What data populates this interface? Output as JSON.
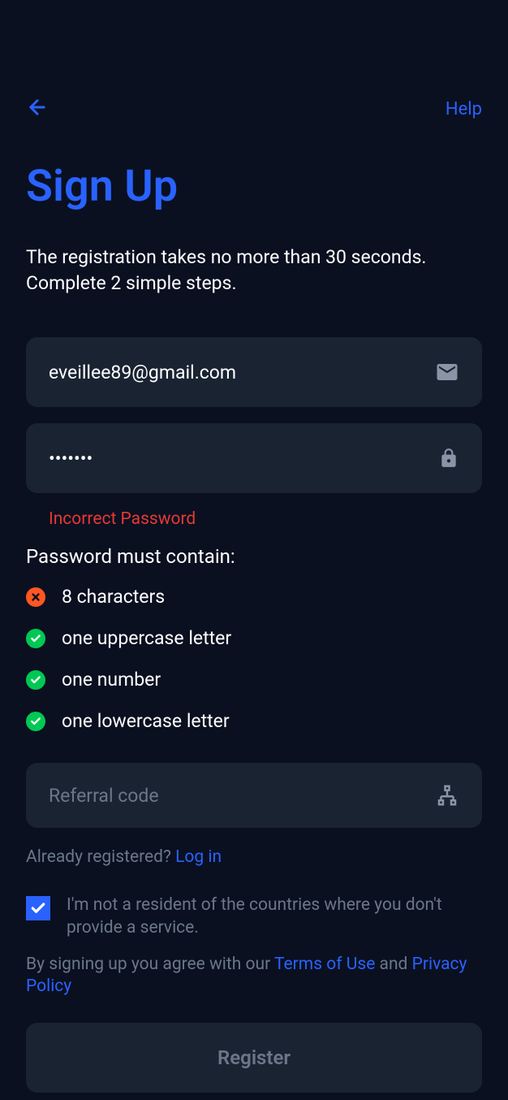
{
  "header": {
    "help_label": "Help"
  },
  "title": "Sign Up",
  "subtitle": "The registration takes no more than 30 seconds. Complete 2 simple steps.",
  "email": {
    "value": "eveillee89@gmail.com"
  },
  "password": {
    "value": "•••••••",
    "error": "Incorrect Password"
  },
  "requirements": {
    "title": "Password must contain:",
    "items": [
      {
        "text": "8 characters",
        "pass": false
      },
      {
        "text": "one uppercase letter",
        "pass": true
      },
      {
        "text": "one number",
        "pass": true
      },
      {
        "text": "one lowercase letter",
        "pass": true
      }
    ]
  },
  "referral": {
    "placeholder": "Referral code"
  },
  "already": {
    "text": "Already registered? ",
    "link": "Log in"
  },
  "consent": {
    "checked": true,
    "label": "I'm not a resident of the countries where you don't provide a service."
  },
  "terms": {
    "prefix": "By signing up you agree with our  ",
    "link1": "Terms of Use",
    "mid": "  and ",
    "link2": "Privacy Policy"
  },
  "register_label": "Register"
}
